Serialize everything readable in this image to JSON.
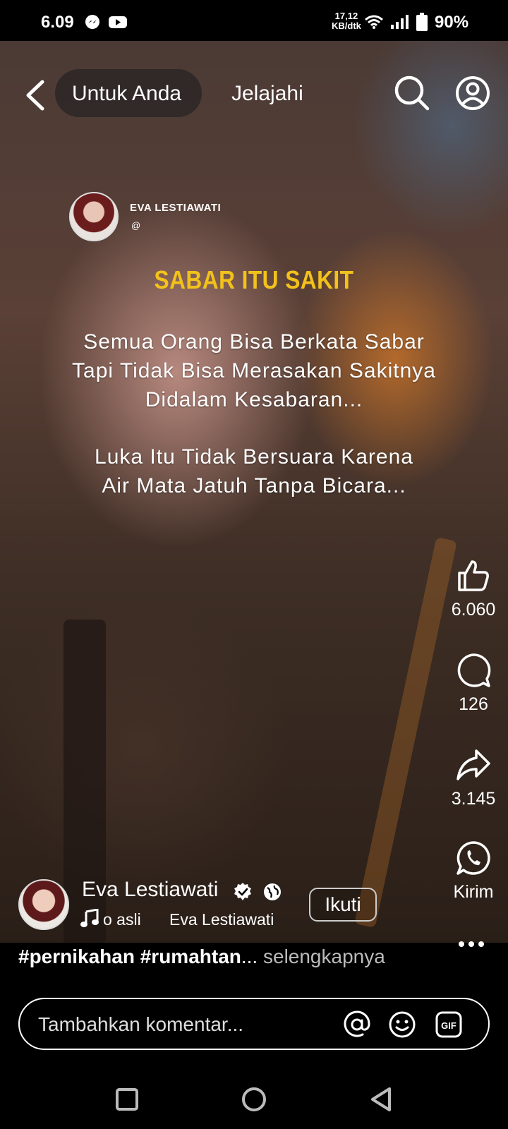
{
  "status_bar": {
    "time": "6.09",
    "net_speed_value": "17,12",
    "net_speed_unit": "KB/dtk",
    "battery": "90%"
  },
  "top_nav": {
    "tabs": [
      {
        "label": "Untuk Anda",
        "active": true
      },
      {
        "label": "Jelajahi",
        "active": false
      }
    ]
  },
  "post": {
    "overlay_author": "EVA LESTIAWATI",
    "overlay_handle": "@",
    "headline": "SABAR ITU SAKIT",
    "quote_lines": [
      "Semua Orang Bisa Berkata Sabar",
      "Tapi Tidak Bisa Merasakan Sakitnya",
      "Didalam Kesabaran...",
      "Luka Itu Tidak Bersuara Karena",
      "Air Mata Jatuh Tanpa Bicara..."
    ]
  },
  "actions": {
    "like_count": "6.060",
    "comment_count": "126",
    "share_count": "3.145",
    "send_label": "Kirim"
  },
  "author": {
    "name": "Eva Lestiawati",
    "music_text": "o asli",
    "music_artist": "Eva Lestiawati",
    "follow_label": "Ikuti"
  },
  "caption": {
    "tags": "#pernikahan #rumahtan",
    "ellipsis": "...",
    "more": " selengkapnya"
  },
  "comment": {
    "placeholder": "Tambahkan komentar..."
  },
  "colors": {
    "headline": "#f2c21b",
    "background": "#000000"
  }
}
